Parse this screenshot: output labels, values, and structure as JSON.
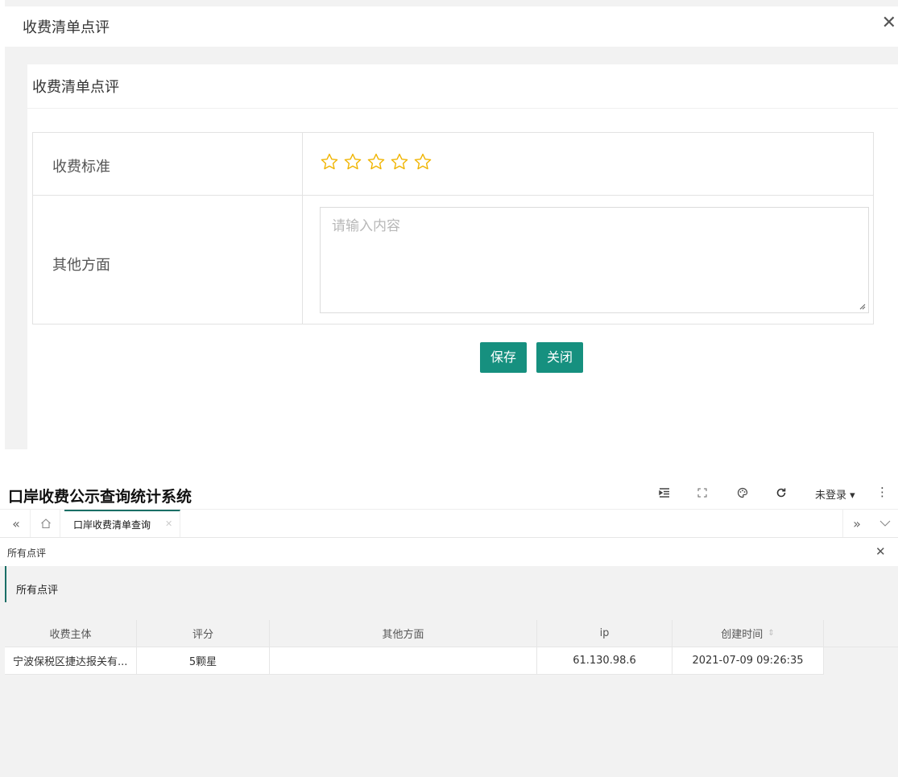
{
  "dialog": {
    "title": "收费清单点评",
    "card_title": "收费清单点评",
    "form": {
      "standard_label": "收费标准",
      "rating": 0,
      "rating_max": 5,
      "other_label": "其他方面",
      "other_placeholder": "请输入内容",
      "other_value": ""
    },
    "buttons": {
      "save": "保存",
      "close": "关闭"
    }
  },
  "app": {
    "title": "口岸收费公示查询统计系统",
    "user_menu": "未登录 ▾",
    "tabs": [
      {
        "label": "口岸收费清单查询"
      }
    ],
    "content": {
      "header_title": "所有点评",
      "panel_title": "所有点评",
      "columns": [
        "收费主体",
        "评分",
        "其他方面",
        "ip",
        "创建时间"
      ],
      "rows": [
        {
          "subject": "宁波保税区捷达报关有...",
          "score": "5颗星",
          "other": "",
          "ip": "61.130.98.6",
          "created_at": "2021-07-09 09:26:35"
        }
      ]
    }
  },
  "colors": {
    "primary": "#16907f",
    "tab_accent": "#1a6f66",
    "star": "#f0b400"
  }
}
